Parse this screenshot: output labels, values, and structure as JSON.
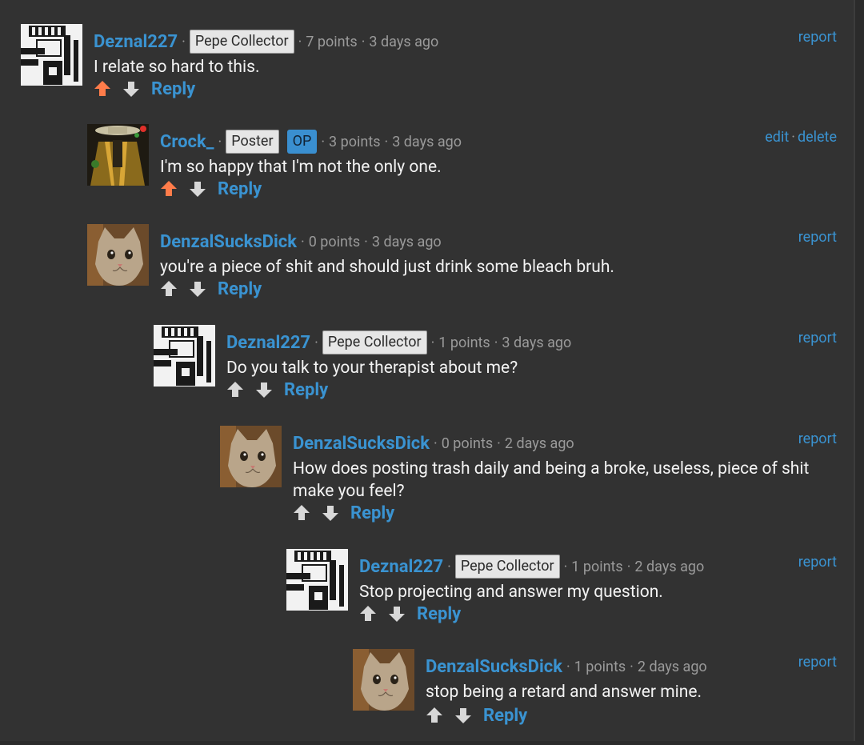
{
  "colors": {
    "background": "#323232",
    "link": "#3a93d1",
    "upvote_active": "#ff7c4a",
    "vote_default": "#d8d8d8",
    "op_badge": "#3a8fd0"
  },
  "comments": [
    {
      "username": "Deznal227",
      "flair": "Pepe Collector",
      "points": "7 points",
      "time": "3 days ago",
      "text": "I relate so hard to this.",
      "reply_label": "Reply",
      "report_label": "report"
    },
    {
      "username": "Crock_",
      "flair": "Poster",
      "op": "OP",
      "points": "3 points",
      "time": "3 days ago",
      "text": "I'm so happy that I'm not the only one.",
      "reply_label": "Reply",
      "edit_label": "edit",
      "delete_label": "delete"
    },
    {
      "username": "DenzalSucksDick",
      "points": "0 points",
      "time": "3 days ago",
      "text": "you're a piece of shit and should just drink some bleach bruh.",
      "reply_label": "Reply",
      "report_label": "report"
    },
    {
      "username": "Deznal227",
      "flair": "Pepe Collector",
      "points": "1 points",
      "time": "3 days ago",
      "text": "Do you talk to your therapist about me?",
      "reply_label": "Reply",
      "report_label": "report"
    },
    {
      "username": "DenzalSucksDick",
      "points": "0 points",
      "time": "2 days ago",
      "text_line1": "How does posting trash daily and being a broke, useless, piece of shit",
      "text_line2": "make you feel?",
      "reply_label": "Reply",
      "report_label": "report"
    },
    {
      "username": "Deznal227",
      "flair": "Pepe Collector",
      "points": "1 points",
      "time": "2 days ago",
      "text": "Stop projecting and answer my question.",
      "reply_label": "Reply",
      "report_label": "report"
    },
    {
      "username": "DenzalSucksDick",
      "points": "1 points",
      "time": "2 days ago",
      "text": "stop being a retard and answer mine.",
      "reply_label": "Reply",
      "report_label": "report"
    }
  ]
}
